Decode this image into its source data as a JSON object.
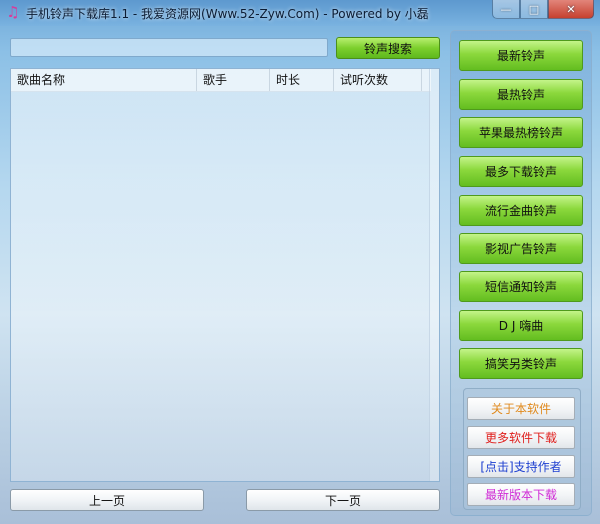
{
  "window": {
    "title": "手机铃声下载库1.1 - 我爱资源网(Www.52-Zyw.Com) - Powered by 小磊",
    "icon": "music-note-icon",
    "controls": {
      "minimize": "—",
      "maximize": "□",
      "close": "✕"
    }
  },
  "search": {
    "value": "",
    "placeholder": "",
    "button_label": "铃声搜索"
  },
  "table": {
    "columns": [
      "歌曲名称",
      "歌手",
      "时长",
      "试听次数"
    ],
    "rows": []
  },
  "pager": {
    "prev_label": "上一页",
    "next_label": "下一页"
  },
  "categories": [
    "最新铃声",
    "最热铃声",
    "苹果最热榜铃声",
    "最多下载铃声",
    "流行金曲铃声",
    "影视广告铃声",
    "短信通知铃声",
    "D J 嗨曲",
    "搞笑另类铃声"
  ],
  "links": [
    {
      "label": "关于本软件",
      "color": "#e08a1e"
    },
    {
      "label": "更多软件下载",
      "color": "#e0201e"
    },
    {
      "label": "[点击]支持作者",
      "color": "#1d3fd0"
    },
    {
      "label": "最新版本下载",
      "color": "#d02bd6"
    }
  ]
}
